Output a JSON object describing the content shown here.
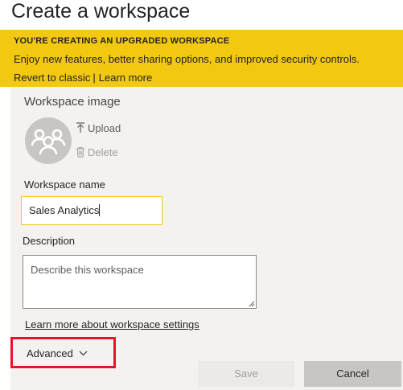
{
  "dialog": {
    "title": "Create a workspace"
  },
  "banner": {
    "heading": "YOU'RE CREATING AN UPGRADED WORKSPACE",
    "body": "Enjoy new features, better sharing options, and improved security controls.",
    "revert_link": "Revert to classic",
    "separator": "|",
    "learn_more_link": "Learn more",
    "color": "#f2c811"
  },
  "workspace_image": {
    "label": "Workspace image",
    "upload_label": "Upload",
    "delete_label": "Delete",
    "avatar_icon": "group-people-icon"
  },
  "workspace_name": {
    "label": "Workspace name",
    "value": "Sales Analytics"
  },
  "description": {
    "label": "Description",
    "placeholder": "Describe this workspace"
  },
  "learn_settings_link": "Learn more about workspace settings",
  "advanced": {
    "label": "Advanced",
    "highlight_color": "#e8112d"
  },
  "buttons": {
    "save": "Save",
    "cancel": "Cancel"
  }
}
